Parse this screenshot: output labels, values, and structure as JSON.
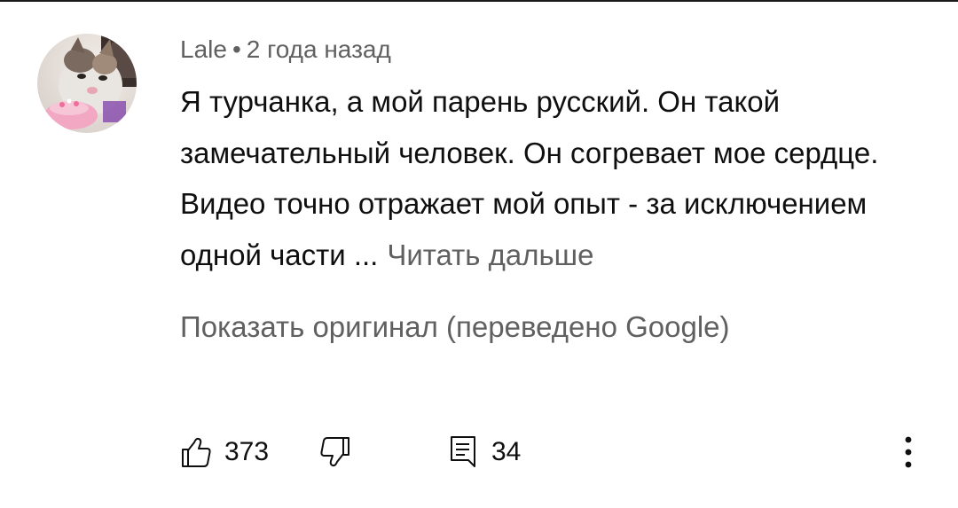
{
  "comment": {
    "author": "Lale",
    "separator": "•",
    "timestamp": "2 года назад",
    "text": "Я турчанка, а мой парень русский. Он такой замечательный человек. Он согревает мое сердце. Видео точно отражает мой опыт - за исключением одной части ...",
    "read_more": "Читать дальше",
    "show_original": "Показать оригинал (переведено Google)",
    "likes": "373",
    "replies": "34"
  },
  "icons": {
    "like": "thumbs-up-icon",
    "dislike": "thumbs-down-icon",
    "reply": "comment-icon",
    "more": "more-vert-icon"
  },
  "colors": {
    "text": "#0f0f0f",
    "secondary": "#606060"
  }
}
